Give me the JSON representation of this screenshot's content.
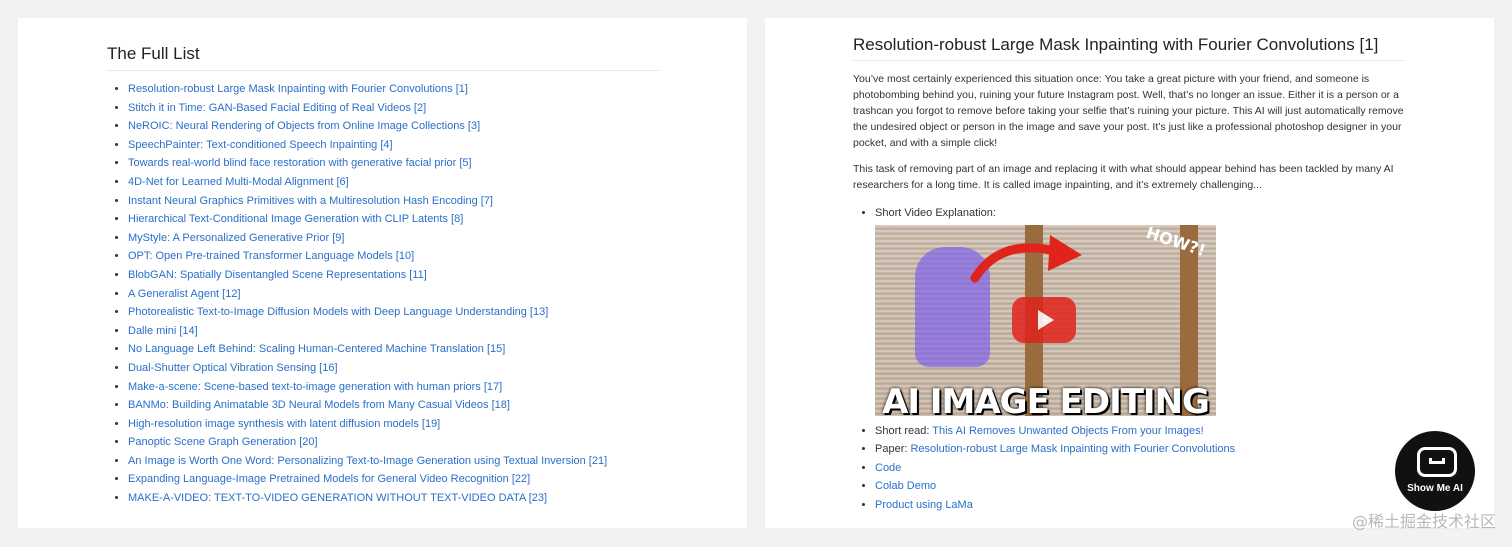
{
  "left": {
    "title": "The Full List",
    "items": [
      "Resolution-robust Large Mask Inpainting with Fourier Convolutions [1]",
      "Stitch it in Time: GAN-Based Facial Editing of Real Videos [2]",
      "NeROIC: Neural Rendering of Objects from Online Image Collections [3]",
      "SpeechPainter: Text-conditioned Speech Inpainting [4]",
      "Towards real-world blind face restoration with generative facial prior [5]",
      "4D-Net for Learned Multi-Modal Alignment [6]",
      "Instant Neural Graphics Primitives with a Multiresolution Hash Encoding [7]",
      "Hierarchical Text-Conditional Image Generation with CLIP Latents [8]",
      "MyStyle: A Personalized Generative Prior [9]",
      "OPT: Open Pre-trained Transformer Language Models [10]",
      "BlobGAN: Spatially Disentangled Scene Representations [11]",
      "A Generalist Agent [12]",
      "Photorealistic Text-to-Image Diffusion Models with Deep Language Understanding [13]",
      "Dalle mini [14]",
      "No Language Left Behind: Scaling Human-Centered Machine Translation [15]",
      "Dual-Shutter Optical Vibration Sensing [16]",
      "Make-a-scene: Scene-based text-to-image generation with human priors [17]",
      "BANMo: Building Animatable 3D Neural Models from Many Casual Videos [18]",
      "High-resolution image synthesis with latent diffusion models [19]",
      "Panoptic Scene Graph Generation [20]",
      "An Image is Worth One Word: Personalizing Text-to-Image Generation using Textual Inversion [21]",
      "Expanding Language-Image Pretrained Models for General Video Recognition [22]",
      "MAKE-A-VIDEO: TEXT-TO-VIDEO GENERATION WITHOUT TEXT-VIDEO DATA [23]"
    ]
  },
  "right": {
    "title": "Resolution-robust Large Mask Inpainting with Fourier Convolutions [1]",
    "para1": "You’ve most certainly experienced this situation once: You take a great picture with your friend, and someone is photobombing behind you, ruining your future Instagram post. Well, that’s no longer an issue. Either it is a person or a trashcan you forgot to remove before taking your selfie that’s ruining your picture. This AI will just automatically remove the undesired object or person in the image and save your post. It’s just like a professional photoshop designer in your pocket, and with a simple click!",
    "para2": "This task of removing part of an image and replacing it with what should appear behind has been tackled by many AI researchers for a long time. It is called image inpainting, and it’s extremely challenging...",
    "video_label": "Short Video Explanation:",
    "thumb_caption": "AI IMAGE EDITING",
    "thumb_tag": "HOW?!",
    "short_read_label": "Short read: ",
    "short_read_link": "This AI Removes Unwanted Objects From your Images!",
    "paper_label": "Paper: ",
    "paper_link": "Resolution-robust Large Mask Inpainting with Fourier Convolutions",
    "code_link": "Code",
    "colab_link": "Colab Demo",
    "product_link": "Product using LaMa"
  },
  "badge": {
    "text": "Show Me AI"
  },
  "watermark": "@稀土掘金技术社区",
  "colors": {
    "link": "#2a6fc9",
    "background": "#f2f2f2",
    "panel": "#ffffff"
  }
}
